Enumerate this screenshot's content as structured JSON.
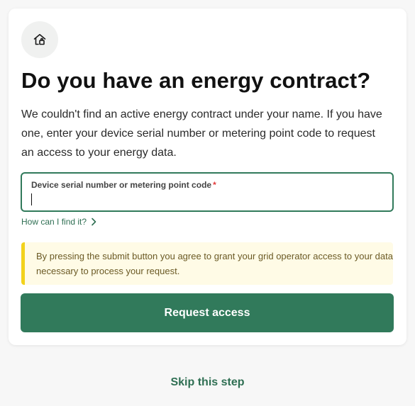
{
  "header": {
    "icon": "house-icon",
    "title": "Do you have an energy contract?"
  },
  "description": "We couldn't find an active energy contract under your name. If you have one, enter your device serial number or metering point code to request an access to your energy data.",
  "form": {
    "field_label": "Device serial number or metering point code",
    "required_marker": "*",
    "field_value": "",
    "help_link": "How can I find it?",
    "help_icon": "chevron-right-icon"
  },
  "notice": {
    "text": "By pressing the submit button you agree to grant your grid operator access to your data necessary to process your request."
  },
  "actions": {
    "submit_label": "Request access",
    "skip_label": "Skip this step"
  },
  "colors": {
    "primary": "#317a5b",
    "notice_bg": "#fffbe6",
    "notice_accent": "#f2d21b",
    "required": "#e23a3a"
  }
}
